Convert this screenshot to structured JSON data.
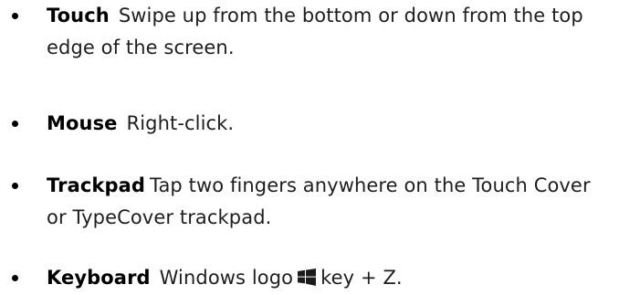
{
  "items": [
    {
      "term": "Touch",
      "text": "Swipe up from the bottom or down from the top edge of the screen."
    },
    {
      "term": "Mouse",
      "text": "Right-click."
    },
    {
      "term": "Trackpad",
      "text": "Tap two fingers anywhere on the Touch Cover or TypeCover trackpad."
    },
    {
      "term": "Keyboard",
      "text_before": "Windows logo",
      "icon": "windows-logo-icon",
      "text_after": "key + Z."
    }
  ]
}
